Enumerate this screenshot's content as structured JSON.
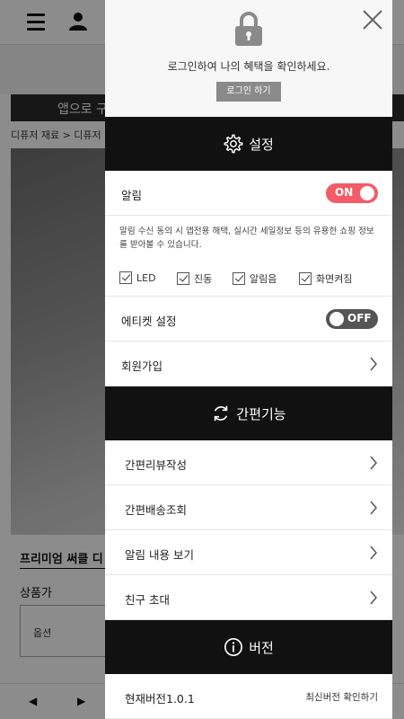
{
  "background": {
    "banner_text": "앱으로 구매",
    "breadcrumb": "디퓨저 재료 > 디퓨저",
    "product_title": "프리미엄 써클 디",
    "price_label": "상품가",
    "option_label": "옵션",
    "arrow_left": "◀",
    "arrow_right": "▶"
  },
  "drawer": {
    "login_text": "로그인하여 나의 혜택을 확인하세요.",
    "login_button": "로그인 하기",
    "settings": {
      "title": "설정",
      "notification_label": "알림",
      "notification_toggle": "ON",
      "notification_desc": "알림 수신 동의 시 앱전용 해택, 실시간 세일정보 등의 유용한 쇼핑 정보를 받아볼 수 있습니다.",
      "options": [
        "LED",
        "진동",
        "알림음",
        "화면켜짐"
      ],
      "etiquette_label": "에티켓 설정",
      "etiquette_toggle": "OFF",
      "signup_label": "회원가입"
    },
    "quick": {
      "title": "간편기능",
      "items": [
        "간편리뷰작성",
        "간편배송조회",
        "알림 내용 보기",
        "친구 초대"
      ]
    },
    "version": {
      "title": "버전",
      "current": "현재버전1.0.1",
      "check_latest": "최신버전 확인하기"
    }
  },
  "colors": {
    "toggle_on": "#f25c67",
    "toggle_off": "#555555",
    "header_bg": "#111111"
  }
}
